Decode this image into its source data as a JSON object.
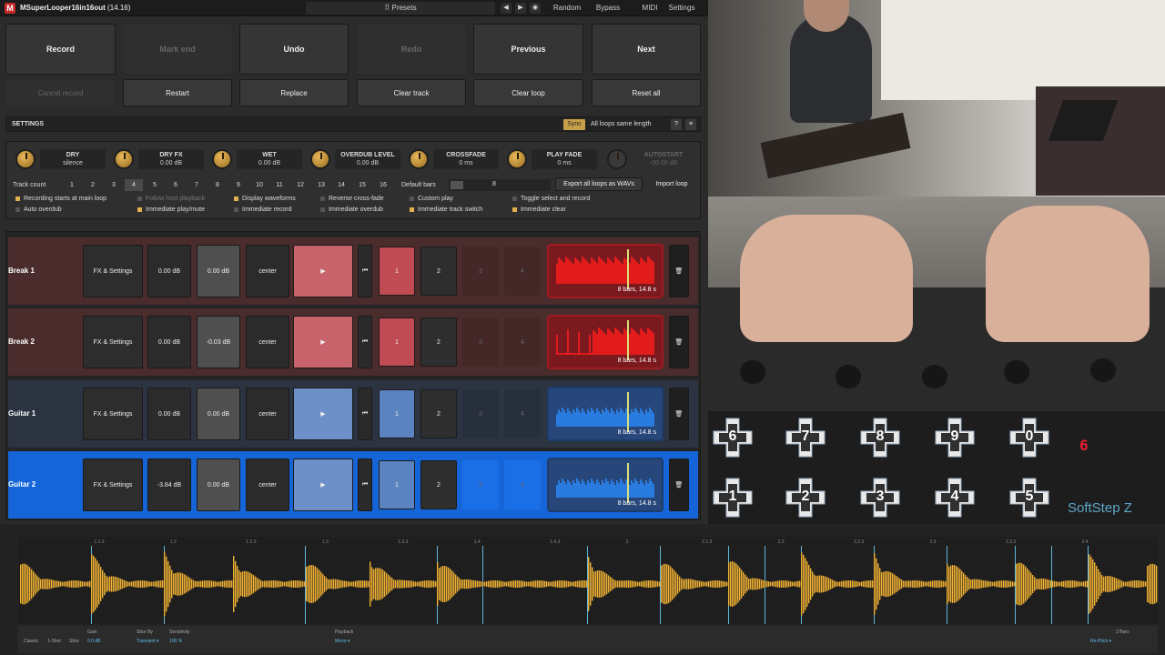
{
  "plugin": {
    "name": "MSuperLooper16in16out",
    "version": "(14.16)",
    "presets": "Presets",
    "top_buttons": [
      "Random",
      "Bypass",
      "MIDI",
      "Settings"
    ],
    "icons": {
      "prev": "◀",
      "next": "▶",
      "extra": "◉"
    }
  },
  "actions": {
    "row1": [
      "Record",
      "Mark end",
      "Undo",
      "Redo",
      "Previous",
      "Next"
    ],
    "row2": [
      "Cancel record",
      "Restart",
      "Replace",
      "Clear track",
      "Clear loop",
      "Reset all"
    ]
  },
  "settings": {
    "title": "SETTINGS",
    "sync": "Sync",
    "all_same": "All loops same length",
    "help": "?",
    "menu": "≡"
  },
  "knobs": [
    {
      "label": "DRY",
      "value": "silence"
    },
    {
      "label": "DRY FX",
      "value": "0.00 dB"
    },
    {
      "label": "WET",
      "value": "0.00 dB"
    },
    {
      "label": "OVERDUB LEVEL",
      "value": "0.00 dB"
    },
    {
      "label": "CROSSFADE",
      "value": "0 ms"
    },
    {
      "label": "PLAY FADE",
      "value": "0 ms"
    }
  ],
  "autostart": {
    "label": "AUTOSTART",
    "value": "-20.00 dB"
  },
  "track_count": {
    "label": "Track count",
    "options": [
      "1",
      "2",
      "3",
      "4",
      "5",
      "6",
      "7",
      "8",
      "9",
      "10",
      "11",
      "12",
      "13",
      "14",
      "15",
      "16"
    ],
    "selected": "4"
  },
  "default_bars": {
    "label": "Default bars",
    "value": "8"
  },
  "export_label": "Export all loops as WAVs",
  "import_label": "Import loop",
  "options": [
    {
      "label": "Recording starts at main loop",
      "on": true
    },
    {
      "label": "Follow host playback",
      "on": false,
      "dim": true
    },
    {
      "label": "Display waveforms",
      "on": true
    },
    {
      "label": "Reverse cross-fade",
      "on": false
    },
    {
      "label": "Custom play",
      "on": false
    },
    {
      "label": "Toggle select and record",
      "on": false
    },
    {
      "label": "Auto overdub",
      "on": false
    },
    {
      "label": "Immediate play/mute",
      "on": true
    },
    {
      "label": "Immediate record",
      "on": false
    },
    {
      "label": "Immediate overdub",
      "on": false
    },
    {
      "label": "Immediate track switch",
      "on": true
    },
    {
      "label": "Immediate clear",
      "on": true
    }
  ],
  "tracks": [
    {
      "name": "Break 1",
      "fx": "FX & Settings",
      "gain": "0.00 dB",
      "vol": "0.00 dB",
      "pan": "center",
      "play": "▶",
      "rew": "⏮",
      "n1": "1",
      "n2": "2",
      "n3": "3",
      "n4": "4",
      "wave_label": "8 bars, 14.8 s",
      "del": "🗑",
      "color": "red"
    },
    {
      "name": "Break 2",
      "fx": "FX & Settings",
      "gain": "0.00 dB",
      "vol": "-0.03 dB",
      "pan": "center",
      "play": "▶",
      "rew": "⏮",
      "n1": "1",
      "n2": "2",
      "n3": "3",
      "n4": "4",
      "wave_label": "8 bars, 14.8 s",
      "del": "🗑",
      "color": "red"
    },
    {
      "name": "Guitar 1",
      "fx": "FX & Settings",
      "gain": "0.00 dB",
      "vol": "0.00 dB",
      "pan": "center",
      "play": "▶",
      "rew": "⏮",
      "n1": "1",
      "n2": "2",
      "n3": "3",
      "n4": "4",
      "wave_label": "8 bars, 14.8 s",
      "del": "🗑",
      "color": "blue"
    },
    {
      "name": "Guitar 2",
      "fx": "FX & Settings",
      "gain": "-3.84 dB",
      "vol": "0.00 dB",
      "pan": "center",
      "play": "▶",
      "rew": "⏮",
      "n1": "1",
      "n2": "2",
      "n3": "3",
      "n4": "4",
      "wave_label": "8 bars, 14.8 s",
      "del": "🗑",
      "color": "blue",
      "selected": true
    }
  ],
  "video": {
    "pads_top": [
      "6",
      "7",
      "8",
      "9",
      "0"
    ],
    "pads_bottom": [
      "1",
      "2",
      "3",
      "4",
      "5"
    ],
    "display": "6",
    "brand": "SoftStep Z"
  },
  "editor": {
    "ruler": [
      "1.1.3",
      "1.2",
      "1.2.3",
      "1.3",
      "1.3.3",
      "1.4",
      "1.4.3",
      "2",
      "2.1.3",
      "2.2",
      "2.2.3",
      "2.3",
      "2.3.3",
      "2.4"
    ],
    "controls": [
      {
        "label": "Gain",
        "value": "0.0 dB"
      },
      {
        "label": "Slice By",
        "value": "Transient ▾"
      },
      {
        "label": "Sensitivity",
        "value": "100 %"
      },
      {
        "label": "Playback",
        "value": "Mono ▾"
      }
    ],
    "left_labels": [
      "Classic",
      "1-Shot",
      "Slice"
    ],
    "right": {
      "bars": "2 Bars",
      "mode": "Re-Pitch ▾"
    }
  }
}
